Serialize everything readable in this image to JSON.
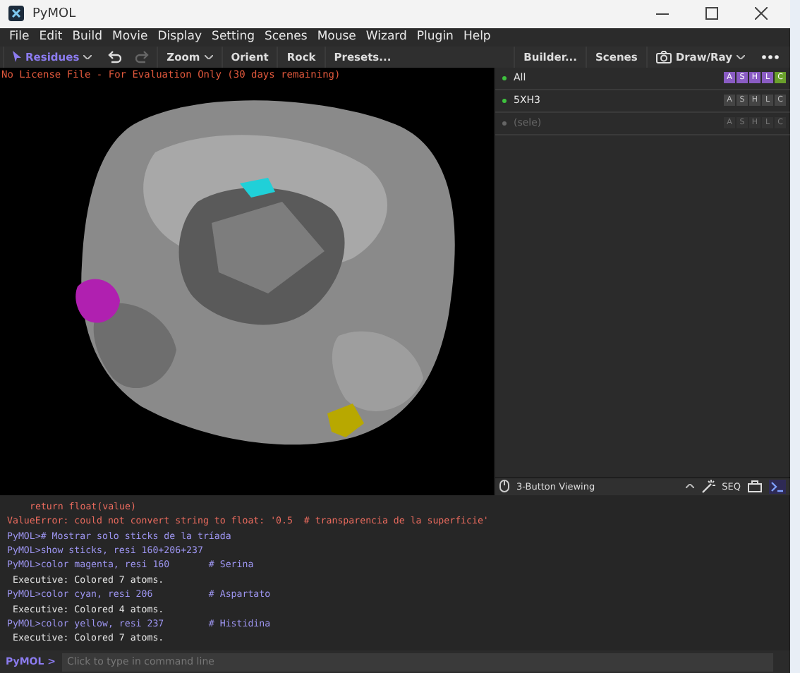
{
  "window": {
    "title": "PyMOL"
  },
  "menu": [
    "File",
    "Edit",
    "Build",
    "Movie",
    "Display",
    "Setting",
    "Scenes",
    "Mouse",
    "Wizard",
    "Plugin",
    "Help"
  ],
  "toolbar": {
    "left": [
      {
        "kind": "mode",
        "label": "Residues"
      },
      {
        "kind": "undo",
        "disabled": false
      },
      {
        "kind": "redo",
        "disabled": true
      },
      {
        "kind": "dropdown",
        "label": "Zoom"
      },
      {
        "kind": "button",
        "label": "Orient"
      },
      {
        "kind": "button",
        "label": "Rock"
      },
      {
        "kind": "button",
        "label": "Presets..."
      }
    ],
    "right": [
      {
        "kind": "button",
        "label": "Builder..."
      },
      {
        "kind": "button",
        "label": "Scenes"
      },
      {
        "kind": "camera",
        "label": "Draw/Ray"
      },
      {
        "kind": "more"
      }
    ]
  },
  "license": "No License File - For Evaluation Only (30 days remaining)",
  "objects": [
    {
      "name": "All",
      "enabled": true,
      "buttons": [
        {
          "label": "A",
          "color": "#8a5cc4"
        },
        {
          "label": "S",
          "color": "#8a5cc4"
        },
        {
          "label": "H",
          "color": "#8a5cc4"
        },
        {
          "label": "L",
          "color": "#8a5cc4"
        },
        {
          "label": "C",
          "color": "#6aa02c"
        }
      ]
    },
    {
      "name": "5XH3",
      "enabled": true,
      "buttons": [
        {
          "label": "A"
        },
        {
          "label": "S"
        },
        {
          "label": "H"
        },
        {
          "label": "L"
        },
        {
          "label": "C"
        }
      ]
    },
    {
      "name": "(sele)",
      "enabled": false,
      "buttons": [
        {
          "label": "A"
        },
        {
          "label": "S"
        },
        {
          "label": "H"
        },
        {
          "label": "L"
        },
        {
          "label": "C"
        }
      ]
    }
  ],
  "mouse_bar": {
    "mode": "3-Button Viewing",
    "seq": "SEQ"
  },
  "console": [
    {
      "kind": "traceback",
      "text": "return float(value)"
    },
    {
      "kind": "error",
      "text": "ValueError: could not convert string to float: '0.5  # transparencia de la superficie'"
    },
    {
      "kind": "command",
      "text": "PyMOL># Mostrar solo sticks de la tríada"
    },
    {
      "kind": "command",
      "text": "PyMOL>show sticks, resi 160+206+237"
    },
    {
      "kind": "command",
      "text": "PyMOL>color magenta, resi 160       # Serina"
    },
    {
      "kind": "output",
      "text": " Executive: Colored 7 atoms."
    },
    {
      "kind": "command",
      "text": "PyMOL>color cyan, resi 206          # Aspartato"
    },
    {
      "kind": "output",
      "text": " Executive: Colored 4 atoms."
    },
    {
      "kind": "command",
      "text": "PyMOL>color yellow, resi 237        # Histidina"
    },
    {
      "kind": "output",
      "text": " Executive: Colored 7 atoms."
    }
  ],
  "command_line": {
    "prompt": "PyMOL >",
    "placeholder": "Click to type in command line"
  }
}
